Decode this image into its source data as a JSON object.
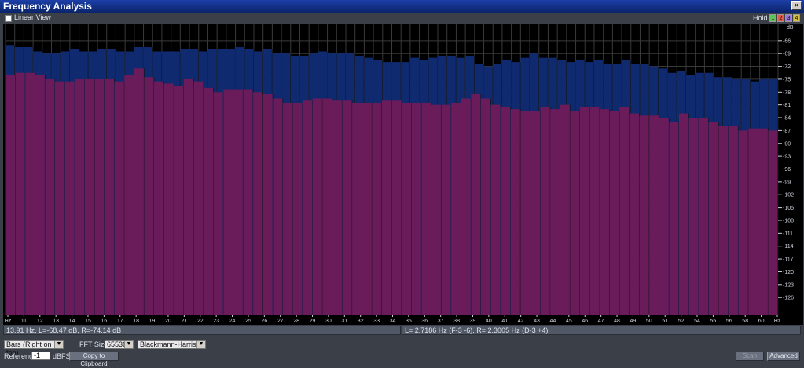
{
  "window": {
    "title": "Frequency Analysis",
    "close_glyph": "×"
  },
  "toolbar": {
    "linear_view_label": "Linear View",
    "hold_label": "Hold",
    "hold_buttons": [
      {
        "label": "1",
        "color": "#62c25a"
      },
      {
        "label": "2",
        "color": "#e25a4a"
      },
      {
        "label": "3",
        "color": "#9a7ad6"
      },
      {
        "label": "4",
        "color": "#d8c34a"
      }
    ]
  },
  "status": {
    "cursor": "13.91 Hz, L=-68.47 dB, R=-74.14 dB",
    "pitch": "L= 2.7186 Hz (F-3 -6), R= 2.3005 Hz (D-3 +4)"
  },
  "controls": {
    "graph_type": "Bars (Right on top)",
    "fft_size_label": "FFT Size",
    "fft_size": "65536",
    "window_function": "Blackmann-Harris",
    "reference_label": "Reference",
    "reference_value": "-1",
    "reference_unit": "dBFS",
    "copy_button": "Copy to Clipboard",
    "scan_button": "Scan",
    "advanced_button": "Advanced"
  },
  "chart_data": {
    "type": "bar",
    "xlabel": "Hz",
    "ylabel": "dB",
    "ylim": [
      -130,
      -62
    ],
    "y_ticks": [
      -66,
      -69,
      -72,
      -75,
      -78,
      -81,
      -84,
      -87,
      -90,
      -93,
      -96,
      -99,
      -102,
      -105,
      -108,
      -111,
      -114,
      -117,
      -120,
      -123,
      -126
    ],
    "x_tick_labels": [
      "Hz",
      "11",
      "12",
      "13",
      "14",
      "15",
      "16",
      "17",
      "18",
      "19",
      "20",
      "21",
      "22",
      "23",
      "24",
      "25",
      "26",
      "27",
      "28",
      "29",
      "30",
      "31",
      "32",
      "33",
      "34",
      "35",
      "36",
      "37",
      "38",
      "39",
      "40",
      "41",
      "42",
      "43",
      "44",
      "45",
      "46",
      "47",
      "48",
      "49",
      "50",
      "51",
      "52",
      "54",
      "55",
      "56",
      "58",
      "60",
      "Hz"
    ],
    "series": [
      {
        "color": "#0f2a6e",
        "values": [
          -67,
          -67.5,
          -67.5,
          -68.5,
          -69,
          -69,
          -68.5,
          -68,
          -68.5,
          -68.5,
          -68,
          -68,
          -68.5,
          -68.5,
          -67.5,
          -67.5,
          -68.5,
          -68.5,
          -68.5,
          -68,
          -68,
          -68.5,
          -68,
          -68,
          -68,
          -67.5,
          -68,
          -68.5,
          -68,
          -69,
          -69,
          -69.5,
          -69.5,
          -69,
          -68.5,
          -69,
          -69,
          -69,
          -69.5,
          -70,
          -70.5,
          -71,
          -71,
          -71,
          -70,
          -70.5,
          -70,
          -69.5,
          -69.5,
          -70,
          -69.5,
          -71.5,
          -72,
          -71.5,
          -70.5,
          -71,
          -70,
          -69,
          -70,
          -70,
          -70.5,
          -71,
          -70.5,
          -71,
          -70.5,
          -71.5,
          -71.5,
          -70.5,
          -71.5,
          -71.5,
          -72,
          -72.5,
          -73.5,
          -73,
          -74,
          -73.5,
          -73.5,
          -74.5,
          -74.5,
          -75,
          -75,
          -75.5,
          -75,
          -75
        ]
      },
      {
        "color": "#6a1b5a",
        "values": [
          -74,
          -73.5,
          -73.5,
          -74,
          -75,
          -75.5,
          -75.5,
          -75,
          -75,
          -75,
          -75,
          -75.5,
          -74,
          -72.5,
          -74.5,
          -75.5,
          -76,
          -76.5,
          -75,
          -75.5,
          -77,
          -78,
          -77.5,
          -77.5,
          -77.5,
          -78,
          -78.5,
          -79.5,
          -80.5,
          -80.5,
          -80,
          -79.5,
          -79.5,
          -80,
          -80,
          -80.5,
          -80.5,
          -80.5,
          -80,
          -80,
          -80.5,
          -80.5,
          -80.5,
          -81,
          -81,
          -80.5,
          -79.5,
          -78.5,
          -79.5,
          -81,
          -81.5,
          -82,
          -82.5,
          -82.5,
          -81.5,
          -82,
          -81,
          -82.5,
          -81.5,
          -81.5,
          -82,
          -82.5,
          -81.5,
          -83,
          -83.5,
          -83.5,
          -84,
          -85,
          -83,
          -84,
          -84,
          -85,
          -86,
          -86,
          -87,
          -86.5,
          -86.5,
          -87
        ]
      }
    ]
  }
}
